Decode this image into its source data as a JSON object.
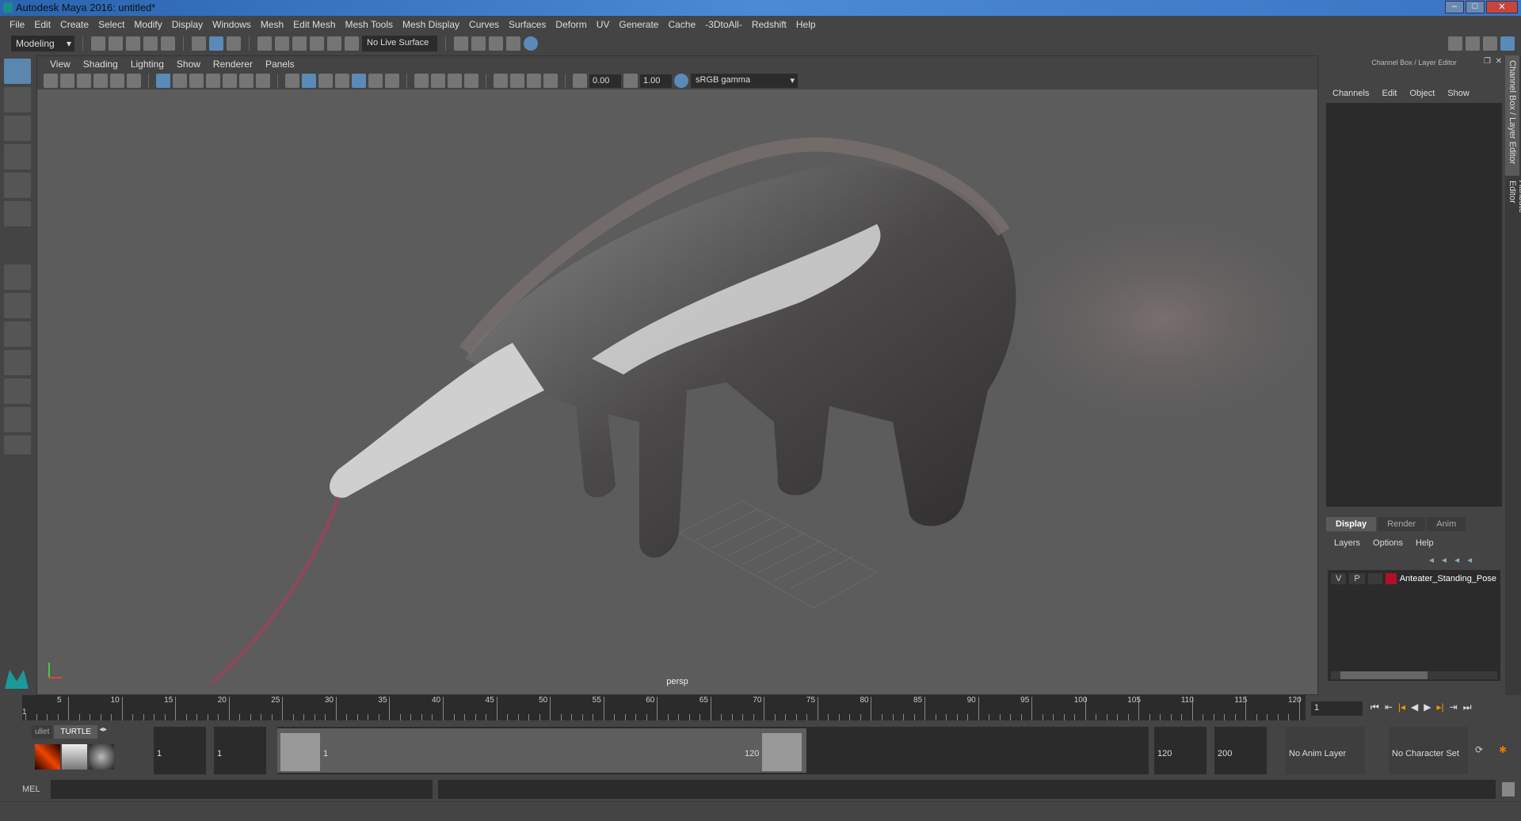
{
  "window": {
    "title": "Autodesk Maya 2016: untitled*"
  },
  "menubar": [
    "File",
    "Edit",
    "Create",
    "Select",
    "Modify",
    "Display",
    "Windows",
    "Mesh",
    "Edit Mesh",
    "Mesh Tools",
    "Mesh Display",
    "Curves",
    "Surfaces",
    "Deform",
    "UV",
    "Generate",
    "Cache",
    "-3DtoAll-",
    "Redshift",
    "Help"
  ],
  "shelf": {
    "mode": "Modeling",
    "live_surface": "No Live Surface"
  },
  "panel": {
    "menu": [
      "View",
      "Shading",
      "Lighting",
      "Show",
      "Renderer",
      "Panels"
    ],
    "exposure": "0.00",
    "gamma": "1.00",
    "colorspace": "sRGB gamma",
    "camera_label": "persp"
  },
  "channel_box": {
    "title": "Channel Box / Layer Editor",
    "menu": [
      "Channels",
      "Edit",
      "Object",
      "Show"
    ]
  },
  "layer_editor": {
    "tabs": [
      "Display",
      "Render",
      "Anim"
    ],
    "menu": [
      "Layers",
      "Options",
      "Help"
    ],
    "layer": {
      "v": "V",
      "p": "P",
      "name": "Anteater_Standing_Pose",
      "color": "#b0102a"
    }
  },
  "side_tabs": [
    "Channel Box / Layer Editor",
    "Attribute Editor"
  ],
  "timeline": {
    "ticks": [
      "5",
      "10",
      "15",
      "20",
      "25",
      "30",
      "35",
      "40",
      "45",
      "50",
      "55",
      "60",
      "65",
      "70",
      "75",
      "80",
      "85",
      "90",
      "95",
      "100",
      "105",
      "110",
      "115",
      "120"
    ],
    "start_label": "1",
    "current_frame": "1"
  },
  "range": {
    "shelf_tabs": [
      "ullet",
      "TURTLE"
    ],
    "start": "1",
    "playback_start": "1",
    "range_start": "1",
    "range_end": "120",
    "playback_end": "120",
    "end": "200",
    "anim_layer": "No Anim Layer",
    "character_set": "No Character Set"
  },
  "mel": {
    "label": "MEL"
  }
}
